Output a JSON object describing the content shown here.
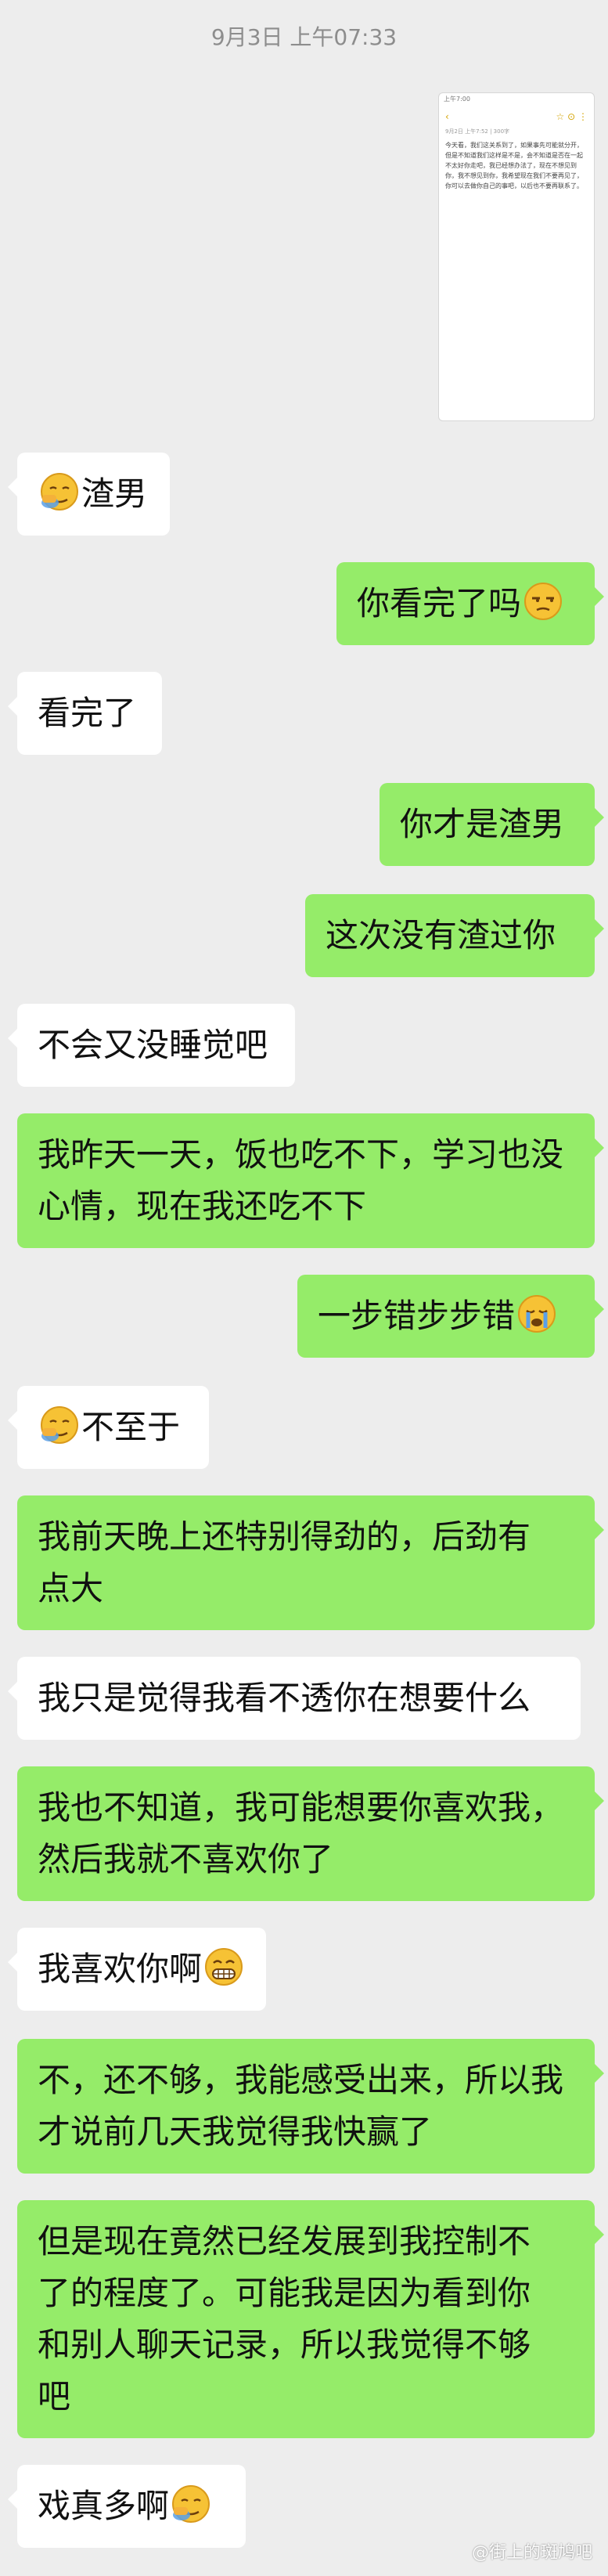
{
  "timestamp": "9月3日 上午07:33",
  "note_preview": {
    "status": "上午7:00",
    "tools": [
      "‹",
      "☆ ⊙ ⋮"
    ],
    "meta": "9月2日 上午7:52 | 300字",
    "body": "今天看，我们这关系到了，如果事先可能就分开，但是不知道我们这样是不是，会不知道是否在一起不太好你走吧，我已经想办法了，现在不想见到你，我不想见到你，我希望现在我们不要再见了，你可以去做你自己的事吧，以后也不要再联系了。"
  },
  "messages": [
    {
      "side": "left",
      "color": "white",
      "lines": [
        "渣男"
      ],
      "emoji_before": "facepalm"
    },
    {
      "side": "right",
      "color": "green",
      "lines": [
        "你看完了吗"
      ],
      "emoji_after": "unamused"
    },
    {
      "side": "left",
      "color": "white",
      "lines": [
        "看完了"
      ]
    },
    {
      "side": "right",
      "color": "green",
      "lines": [
        "你才是渣男"
      ]
    },
    {
      "side": "right",
      "color": "green",
      "lines": [
        "这次没有渣过你"
      ]
    },
    {
      "side": "left",
      "color": "white",
      "lines": [
        "不会又没睡觉吧"
      ]
    },
    {
      "side": "left",
      "color": "green",
      "lines": [
        "我昨天一天，饭也吃不下，学习也没",
        "心情，现在我还吃不下"
      ]
    },
    {
      "side": "right",
      "color": "green",
      "lines": [
        "一步错步步错"
      ],
      "emoji_after": "crying"
    },
    {
      "side": "left",
      "color": "white",
      "lines": [
        "不至于"
      ],
      "emoji_before": "facepalm"
    },
    {
      "side": "left",
      "color": "green",
      "lines": [
        "我前天晚上还特别得劲的，后劲有",
        "点大"
      ]
    },
    {
      "side": "left",
      "color": "white",
      "lines": [
        "我只是觉得我看不透你在想要什么"
      ]
    },
    {
      "side": "left",
      "color": "green",
      "lines": [
        "我也不知道，我可能想要你喜欢我，",
        "然后我就不喜欢你了"
      ]
    },
    {
      "side": "left",
      "color": "white",
      "lines": [
        "我喜欢你啊"
      ],
      "emoji_after": "grin"
    },
    {
      "side": "left",
      "color": "green",
      "lines": [
        "不，还不够，我能感受出来，所以我",
        "才说前几天我觉得我快赢了"
      ]
    },
    {
      "side": "left",
      "color": "green",
      "lines": [
        "但是现在竟然已经发展到我控制不",
        "了的程度了。可能我是因为看到你",
        "和别人聊天记录，所以我觉得不够",
        "吧"
      ]
    },
    {
      "side": "left",
      "color": "white",
      "lines": [
        "戏真多啊"
      ],
      "emoji_after": "facepalm"
    }
  ],
  "watermark": "@街上的斑鸠吧"
}
